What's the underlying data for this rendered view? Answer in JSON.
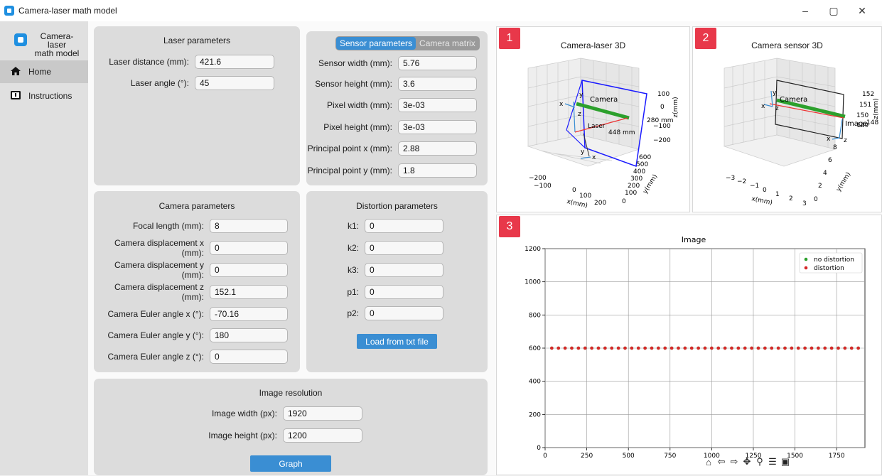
{
  "window": {
    "title": "Camera-laser math model",
    "minimize": "–",
    "maximize": "▢",
    "close": "✕"
  },
  "sidebar": {
    "logo_text": "Camera-laser\nmath model",
    "items": [
      {
        "label": "Home",
        "icon": "home-icon",
        "active": true
      },
      {
        "label": "Instructions",
        "icon": "info-screen-icon",
        "active": false
      }
    ]
  },
  "laser": {
    "title": "Laser parameters",
    "fields": [
      {
        "label": "Laser distance (mm):",
        "value": "421.6"
      },
      {
        "label": "Laser angle (°):",
        "value": "45"
      }
    ]
  },
  "sensor": {
    "tabs": [
      "Sensor parameters",
      "Camera matrix"
    ],
    "active_tab": "Sensor parameters",
    "fields": [
      {
        "label": "Sensor width (mm):",
        "value": "5.76"
      },
      {
        "label": "Sensor height (mm):",
        "value": "3.6"
      },
      {
        "label": "Pixel width (mm):",
        "value": "3e-03"
      },
      {
        "label": "Pixel height (mm):",
        "value": "3e-03"
      },
      {
        "label": "Principal point x (mm):",
        "value": "2.88"
      },
      {
        "label": "Principal point y (mm):",
        "value": "1.8"
      }
    ]
  },
  "camera": {
    "title": "Camera parameters",
    "fields": [
      {
        "label": "Focal length (mm):",
        "value": "8"
      },
      {
        "label": "Camera displacement x (mm):",
        "value": "0"
      },
      {
        "label": "Camera displacement y (mm):",
        "value": "0"
      },
      {
        "label": "Camera displacement z (mm):",
        "value": "152.1"
      },
      {
        "label": "Camera Euler angle x (°):",
        "value": "-70.16"
      },
      {
        "label": "Camera Euler angle y (°):",
        "value": "180"
      },
      {
        "label": "Camera Euler angle z (°):",
        "value": "0"
      }
    ]
  },
  "distortion": {
    "title": "Distortion parameters",
    "fields": [
      {
        "label": "k1:",
        "value": "0"
      },
      {
        "label": "k2:",
        "value": "0"
      },
      {
        "label": "k3:",
        "value": "0"
      },
      {
        "label": "p1:",
        "value": "0"
      },
      {
        "label": "p2:",
        "value": "0"
      }
    ],
    "load_button": "Load from txt file"
  },
  "resolution": {
    "title": "Image resolution",
    "fields": [
      {
        "label": "Image width (px):",
        "value": "1920"
      },
      {
        "label": "Image height (px):",
        "value": "1200"
      }
    ],
    "graph_button": "Graph"
  },
  "plots": {
    "p1": {
      "badge": "1",
      "title": "Camera-laser 3D",
      "labels": {
        "camera": "Camera",
        "laser": "Laser",
        "dist1": "280 mm",
        "dist2": "448 mm",
        "xaxis": "x(mm)",
        "yaxis": "y(mm)",
        "zaxis": "z(mm)",
        "cam_x": "x",
        "cam_y": "y",
        "cam_z": "z",
        "las_x": "x",
        "las_y": "y"
      },
      "xticks": [
        "−200",
        "−100",
        "0",
        "100",
        "200"
      ],
      "yticks": [
        "0",
        "100",
        "200",
        "300",
        "400",
        "500",
        "600"
      ],
      "zticks": [
        "100",
        "0",
        "−100",
        "−200"
      ]
    },
    "p2": {
      "badge": "2",
      "title": "Camera sensor 3D",
      "labels": {
        "camera": "Camera",
        "image": "Image",
        "xaxis": "x(mm)",
        "yaxis": "y(mm)",
        "zaxis": "z(mm)",
        "c_x": "x",
        "c_y": "y",
        "c_z": "z",
        "i_x": "x",
        "i_z": "z"
      },
      "xticks": [
        "−3",
        "−2",
        "−1",
        "0",
        "1",
        "2",
        "3"
      ],
      "yticks": [
        "0",
        "2",
        "4",
        "6",
        "8"
      ],
      "zticks": [
        "152",
        "151",
        "150",
        "149",
        "148"
      ]
    },
    "p3": {
      "badge": "3"
    }
  },
  "chart_data": {
    "type": "scatter",
    "title": "Image",
    "xlabel": "",
    "ylabel": "",
    "xlim": [
      0,
      1920
    ],
    "ylim": [
      0,
      1200
    ],
    "xticks": [
      0,
      250,
      500,
      750,
      1000,
      1250,
      1500,
      1750
    ],
    "yticks": [
      0,
      200,
      400,
      600,
      800,
      1000,
      1200
    ],
    "grid": true,
    "legend_position": "top-right",
    "series": [
      {
        "name": "no distortion",
        "color": "#2ca02c",
        "x": [
          40,
          80,
          120,
          160,
          200,
          240,
          280,
          320,
          360,
          400,
          440,
          480,
          520,
          560,
          600,
          640,
          680,
          720,
          760,
          800,
          840,
          880,
          920,
          960,
          1000,
          1040,
          1080,
          1120,
          1160,
          1200,
          1240,
          1280,
          1320,
          1360,
          1400,
          1440,
          1480,
          1520,
          1560,
          1600,
          1640,
          1680,
          1720,
          1760,
          1800,
          1840,
          1880
        ],
        "y": 600
      },
      {
        "name": "distortion",
        "color": "#d62728",
        "x": [
          40,
          80,
          120,
          160,
          200,
          240,
          280,
          320,
          360,
          400,
          440,
          480,
          520,
          560,
          600,
          640,
          680,
          720,
          760,
          800,
          840,
          880,
          920,
          960,
          1000,
          1040,
          1080,
          1120,
          1160,
          1200,
          1240,
          1280,
          1320,
          1360,
          1400,
          1440,
          1480,
          1520,
          1560,
          1600,
          1640,
          1680,
          1720,
          1760,
          1800,
          1840,
          1880
        ],
        "y": 600
      }
    ]
  },
  "toolbar": {
    "icons": [
      "home-icon",
      "back-icon",
      "forward-icon",
      "pan-icon",
      "zoom-icon",
      "configure-icon",
      "save-icon"
    ]
  }
}
